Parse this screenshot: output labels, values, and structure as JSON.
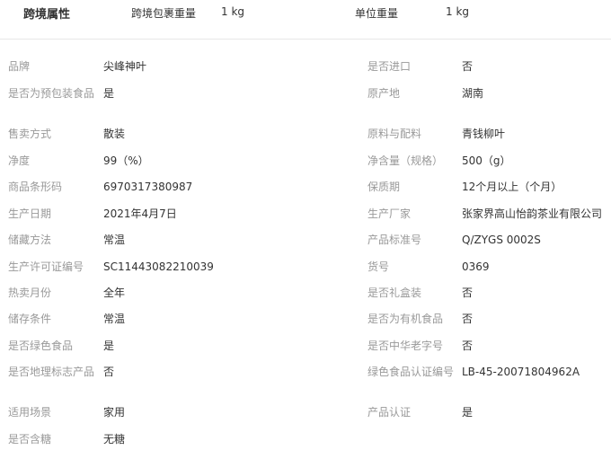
{
  "header": {
    "title": "跨境属性",
    "items": [
      {
        "label": "跨境包裹重量",
        "value": "1 kg"
      },
      {
        "label": "单位重量",
        "value": "1 kg"
      }
    ]
  },
  "rows": [
    {
      "l1": "品牌",
      "v1": "尖峰神叶",
      "l2": "是否进口",
      "v2": "否"
    },
    {
      "l1": "是否为预包装食品",
      "v1": "是",
      "l2": "原产地",
      "v2": "湖南"
    },
    {
      "l1": "售卖方式",
      "v1": "散装",
      "l2": "原料与配料",
      "v2": "青钱柳叶"
    },
    {
      "l1": "净度",
      "v1": "99（%）",
      "l2": "净含量（规格）",
      "v2": "500（g）"
    },
    {
      "l1": "商品条形码",
      "v1": "6970317380987",
      "l2": "保质期",
      "v2": "12个月以上（个月）"
    },
    {
      "l1": "生产日期",
      "v1": "2021年4月7日",
      "l2": "生产厂家",
      "v2": "张家界高山怡韵茶业有限公司"
    },
    {
      "l1": "储藏方法",
      "v1": "常温",
      "l2": "产品标准号",
      "v2": "Q/ZYGS 0002S"
    },
    {
      "l1": "生产许可证编号",
      "v1": "SC11443082210039",
      "l2": "货号",
      "v2": "0369"
    },
    {
      "l1": "热卖月份",
      "v1": "全年",
      "l2": "是否礼盒装",
      "v2": "否"
    },
    {
      "l1": "储存条件",
      "v1": "常温",
      "l2": "是否为有机食品",
      "v2": "否"
    },
    {
      "l1": "是否绿色食品",
      "v1": "是",
      "l2": "是否中华老字号",
      "v2": "否"
    },
    {
      "l1": "是否地理标志产品",
      "v1": "否",
      "l2": "绿色食品认证编号",
      "v2": "LB-45-20071804962A"
    },
    {
      "l1": "适用场景",
      "v1": "家用",
      "l2": "产品认证",
      "v2": "是"
    },
    {
      "l1": "是否含糖",
      "v1": "无糖",
      "l2": "",
      "v2": ""
    }
  ]
}
